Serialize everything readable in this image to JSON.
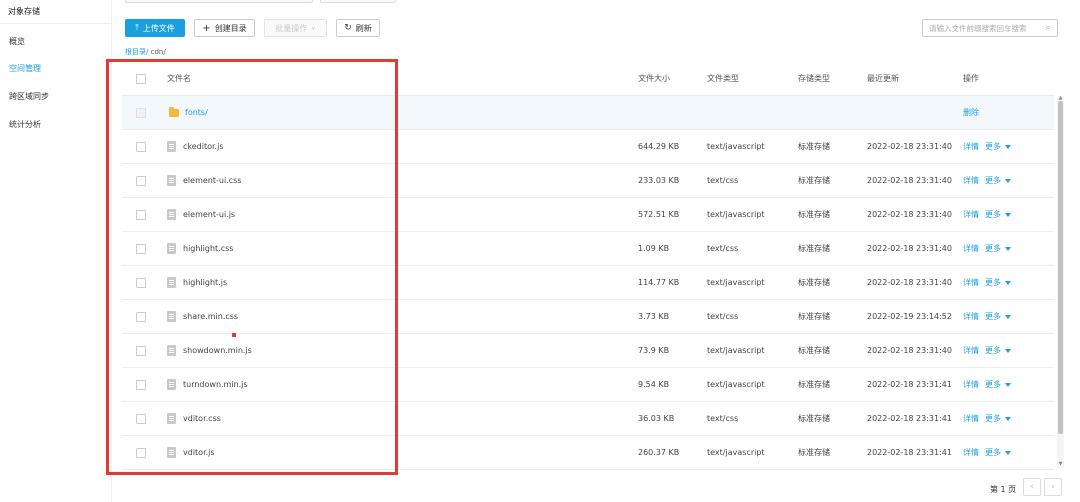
{
  "sidebar": {
    "title": "对象存储",
    "items": [
      {
        "label": "概览",
        "active": false
      },
      {
        "label": "空间管理",
        "active": true
      },
      {
        "label": "跨区域同步",
        "active": false
      },
      {
        "label": "统计分析",
        "active": false
      }
    ]
  },
  "toolbar": {
    "upload_label": "上传文件",
    "upload_icon": "upload-icon",
    "mkdir_label": "创建目录",
    "mkdir_icon": "plus-icon",
    "batch_label": "批量操作",
    "batch_icon": "chevron-down-icon",
    "refresh_label": "刷新",
    "refresh_icon": "refresh-icon"
  },
  "search": {
    "placeholder": "请输入文件前缀搜索回车搜索",
    "icon": "search-icon"
  },
  "breadcrumb": {
    "root": "根目录/",
    "current": "cdn/"
  },
  "table": {
    "headers": {
      "name": "文件名",
      "size": "文件大小",
      "type": "文件类型",
      "storage": "存储类型",
      "updated": "最近更新",
      "actions": "操作"
    },
    "folder": {
      "name": "fonts/",
      "action": "删除"
    },
    "rows": [
      {
        "name": "ckeditor.js",
        "size": "644.29 KB",
        "type": "text/javascript",
        "storage": "标准存储",
        "updated": "2022-02-18 23:31:40"
      },
      {
        "name": "element-ui.css",
        "size": "233.03 KB",
        "type": "text/css",
        "storage": "标准存储",
        "updated": "2022-02-18 23:31:40"
      },
      {
        "name": "element-ui.js",
        "size": "572.51 KB",
        "type": "text/javascript",
        "storage": "标准存储",
        "updated": "2022-02-18 23:31:40"
      },
      {
        "name": "highlight.css",
        "size": "1.09 KB",
        "type": "text/css",
        "storage": "标准存储",
        "updated": "2022-02-18 23:31:40"
      },
      {
        "name": "highlight.js",
        "size": "114.77 KB",
        "type": "text/javascript",
        "storage": "标准存储",
        "updated": "2022-02-18 23:31:40"
      },
      {
        "name": "share.min.css",
        "size": "3.73 KB",
        "type": "text/css",
        "storage": "标准存储",
        "updated": "2022-02-19 23:14:52"
      },
      {
        "name": "showdown.min.js",
        "size": "73.9 KB",
        "type": "text/javascript",
        "storage": "标准存储",
        "updated": "2022-02-18 23:31:40"
      },
      {
        "name": "turndown.min.js",
        "size": "9.54 KB",
        "type": "text/javascript",
        "storage": "标准存储",
        "updated": "2022-02-18 23:31:41"
      },
      {
        "name": "vditor.css",
        "size": "36.03 KB",
        "type": "text/css",
        "storage": "标准存储",
        "updated": "2022-02-18 23:31:41"
      },
      {
        "name": "vditor.js",
        "size": "260.37 KB",
        "type": "text/javascript",
        "storage": "标准存储",
        "updated": "2022-02-18 23:31:41"
      }
    ],
    "row_actions": {
      "detail": "详情",
      "more": "更多"
    }
  },
  "pagination": {
    "label": "第 1 页",
    "prev_icon": "chevron-left-icon",
    "next_icon": "chevron-right-icon"
  },
  "colors": {
    "accent": "#1a9fe0",
    "annotation": "#e53935",
    "folder": "#f5b83d"
  }
}
